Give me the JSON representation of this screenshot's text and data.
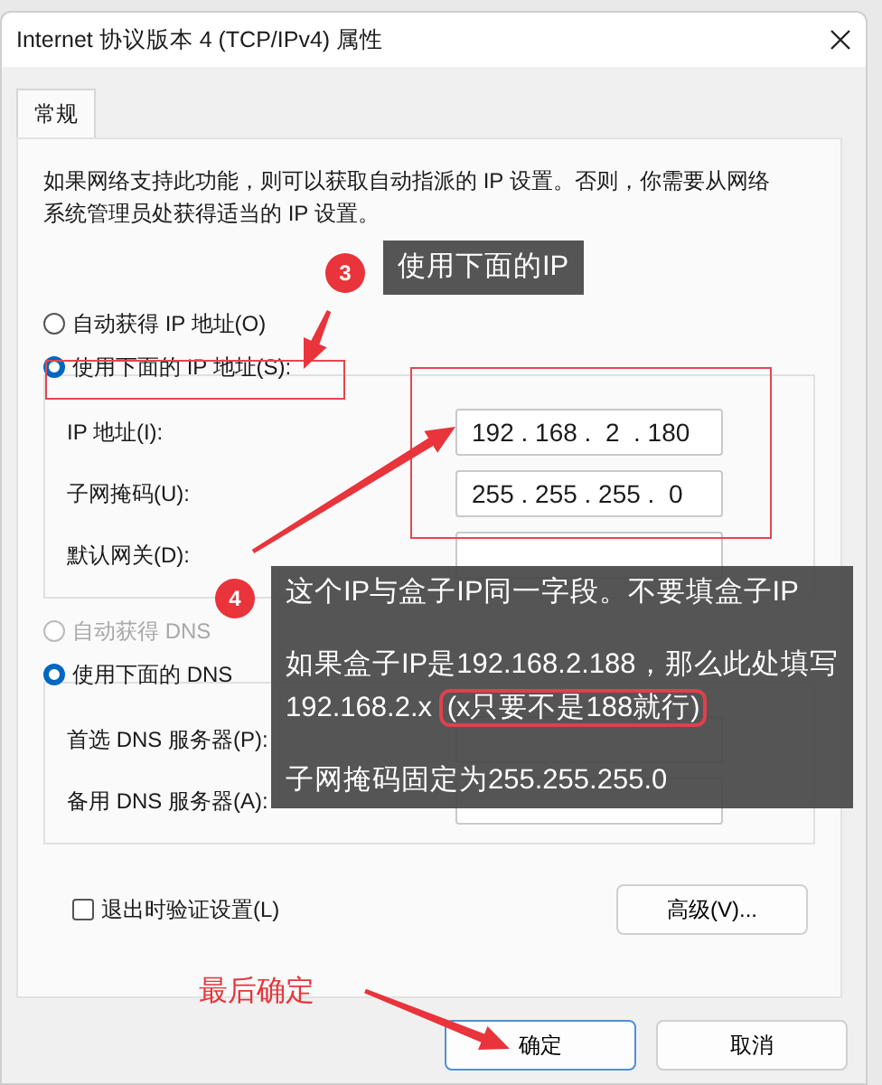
{
  "window": {
    "title": "Internet 协议版本 4 (TCP/IPv4) 属性"
  },
  "tabs": [
    {
      "label": "常规",
      "selected": true
    }
  ],
  "description": "如果网络支持此功能，则可以获取自动指派的 IP 设置。否则，你需要从网络系统管理员处获得适当的 IP 设置。",
  "ip_mode": [
    {
      "label": "自动获得 IP 地址(O)",
      "selected": false,
      "disabled": false
    },
    {
      "label": "使用下面的 IP 地址(S):",
      "selected": true,
      "disabled": false
    }
  ],
  "ip_fields": [
    {
      "label": "IP 地址(I):",
      "value": "192 . 168 .  2  . 180"
    },
    {
      "label": "子网掩码(U):",
      "value": "255 . 255 . 255 .  0"
    },
    {
      "label": "默认网关(D):"
    }
  ],
  "dns_mode": [
    {
      "label": "自动获得 DNS",
      "selected": false,
      "disabled": true
    },
    {
      "label": "使用下面的 DNS",
      "selected": true,
      "disabled": false
    }
  ],
  "dns_fields": [
    {
      "label": "首选 DNS 服务器(P):"
    },
    {
      "label": "备用 DNS 服务器(A):"
    }
  ],
  "validate": {
    "label": "退出时验证设置(L)",
    "checked": false
  },
  "advanced_button": "高级(V)...",
  "buttons": [
    {
      "label": "确定",
      "default": true
    },
    {
      "label": "取消",
      "default": false
    }
  ],
  "annotations": [
    {
      "kind": "step",
      "number": "3",
      "lines": [
        {
          "text": "使用下面的IP"
        }
      ]
    },
    {
      "kind": "step",
      "number": "4",
      "lines": [
        {
          "text": "这个IP与盒子IP同一字段。不要填盒子IP"
        },
        {
          "text": "如果盒子IP是192.168.2.188，那么此处填写"
        },
        {
          "text": "192.168.2.x",
          "highlight": "(x只要不是188就行)"
        },
        {
          "text": "子网掩码固定为255.255.255.0"
        }
      ]
    },
    {
      "kind": "note",
      "text": "最后确定"
    }
  ]
}
